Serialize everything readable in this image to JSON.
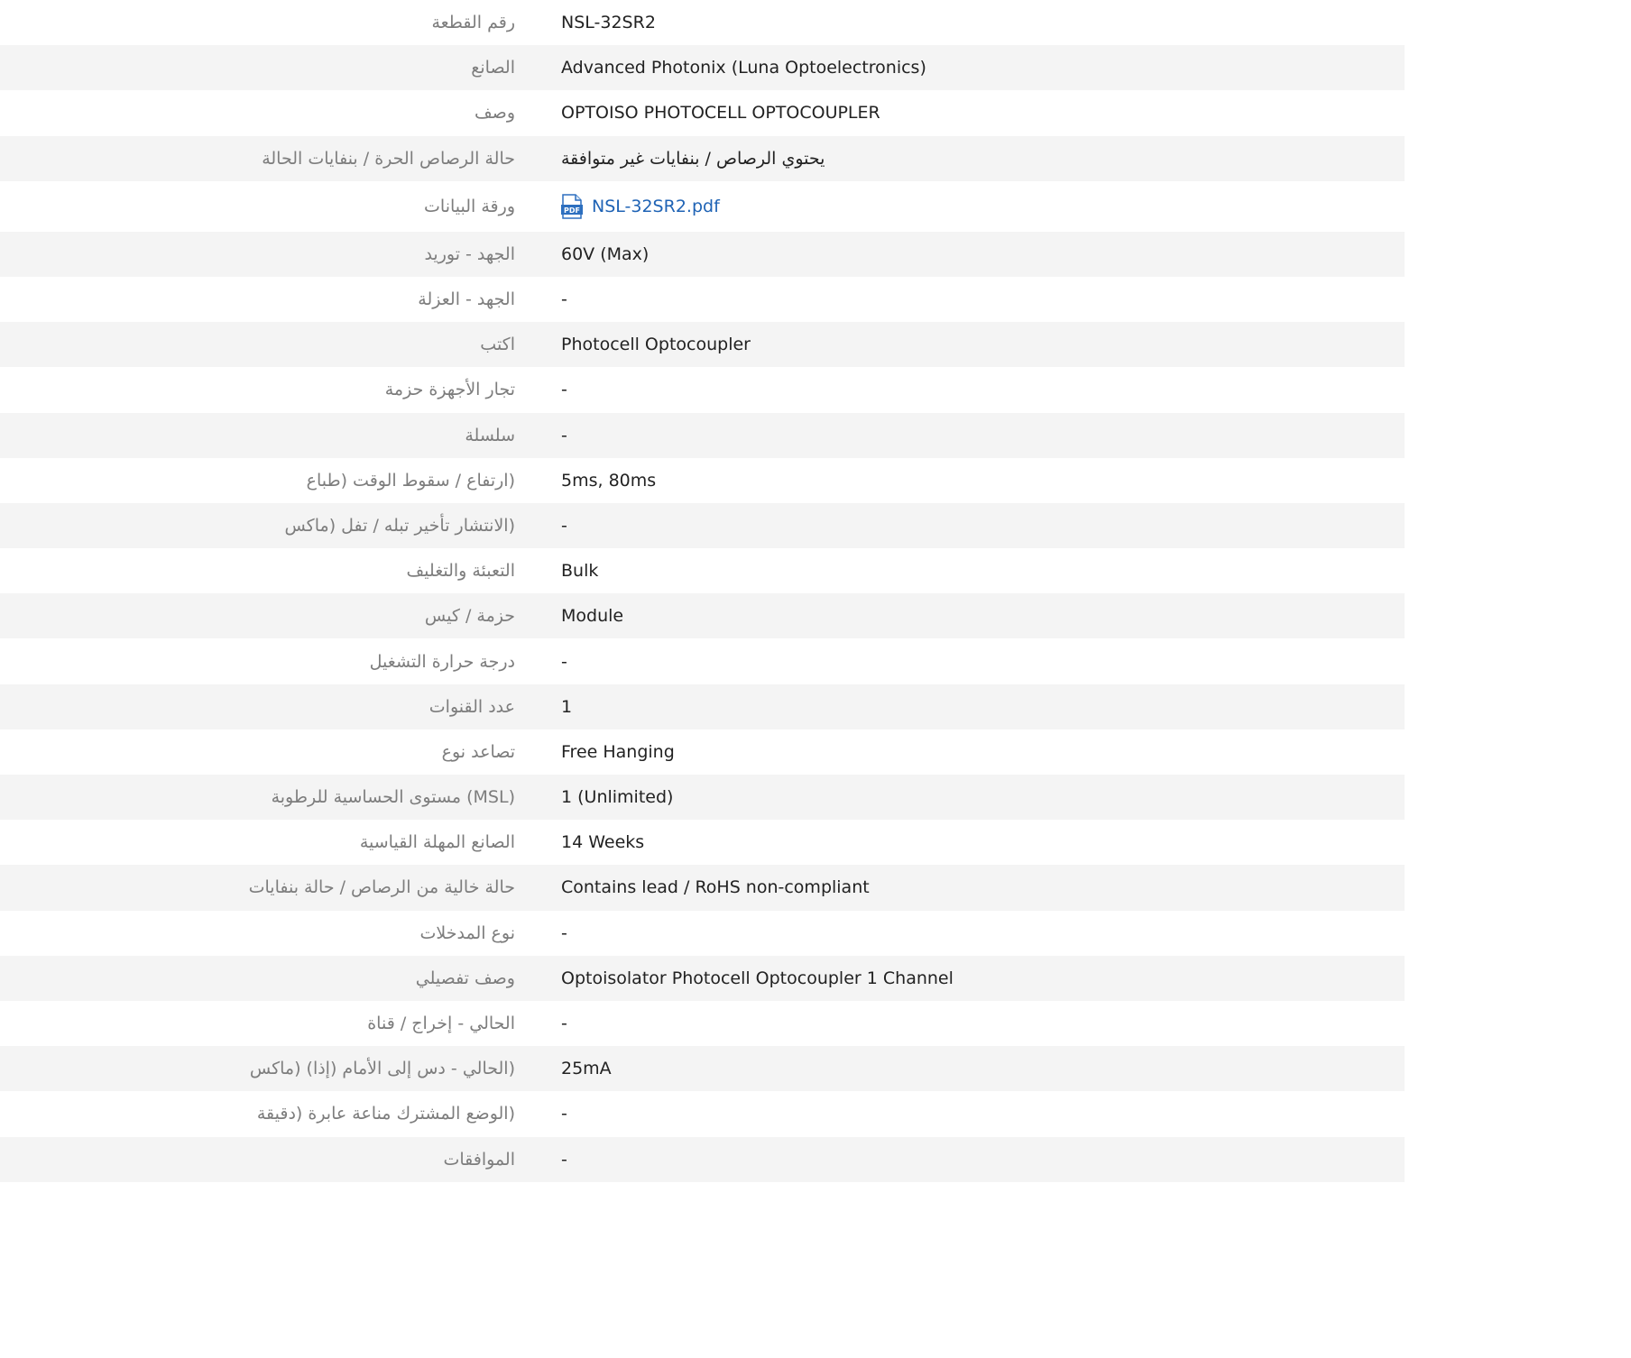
{
  "rows": [
    {
      "label": "رقم القطعة",
      "value": "NSL-32SR2"
    },
    {
      "label": "الصانع",
      "value": "Advanced Photonix (Luna Optoelectronics)"
    },
    {
      "label": "وصف",
      "value": "OPTOISO PHOTOCELL OPTOCOUPLER"
    },
    {
      "label": "حالة الرصاص الحرة / بنفايات الحالة",
      "value": "يحتوي الرصاص / بنفايات غير متوافقة"
    },
    {
      "label": "ورقة البيانات",
      "value": "NSL-32SR2.pdf",
      "icon": "pdf-icon",
      "link_color": "#1f63b5"
    },
    {
      "label": "الجهد - توريد",
      "value": "60V (Max)"
    },
    {
      "label": "الجهد - العزلة",
      "value": "-"
    },
    {
      "label": "اكتب",
      "value": "Photocell Optocoupler"
    },
    {
      "label": "تجار الأجهزة حزمة",
      "value": "-"
    },
    {
      "label": "سلسلة",
      "value": "-"
    },
    {
      "label": "(ارتفاع / سقوط الوقت (طباع",
      "value": "5ms, 80ms"
    },
    {
      "label": "(الانتشار تأخير تبله / تفل (ماكس",
      "value": "-"
    },
    {
      "label": "التعبئة والتغليف",
      "value": "Bulk"
    },
    {
      "label": "حزمة / كيس",
      "value": "Module"
    },
    {
      "label": "درجة حرارة التشغيل",
      "value": "-"
    },
    {
      "label": "عدد القنوات",
      "value": "1"
    },
    {
      "label": "تصاعد نوع",
      "value": "Free Hanging"
    },
    {
      "label": "(MSL) مستوى الحساسية للرطوبة",
      "value": "1 (Unlimited)"
    },
    {
      "label": "الصانع المهلة القياسية",
      "value": "14 Weeks"
    },
    {
      "label": "حالة خالية من الرصاص / حالة بنفايات",
      "value": "Contains lead / RoHS non-compliant"
    },
    {
      "label": "نوع المدخلات",
      "value": "-"
    },
    {
      "label": "وصف تفصيلي",
      "value": "Optoisolator Photocell Optocoupler 1 Channel"
    },
    {
      "label": "الحالي - إخراج / قناة",
      "value": "-"
    },
    {
      "label": "(الحالي - دس إلى الأمام (إذا) (ماكس",
      "value": "25mA"
    },
    {
      "label": "(الوضع المشترك مناعة عابرة (دقيقة",
      "value": "-"
    },
    {
      "label": "الموافقات",
      "value": "-"
    }
  ],
  "colors": {
    "label_text": "#7d7d7d",
    "value_text": "#222222",
    "alt_row_bg": "#f4f4f4",
    "link": "#1f63b5"
  }
}
